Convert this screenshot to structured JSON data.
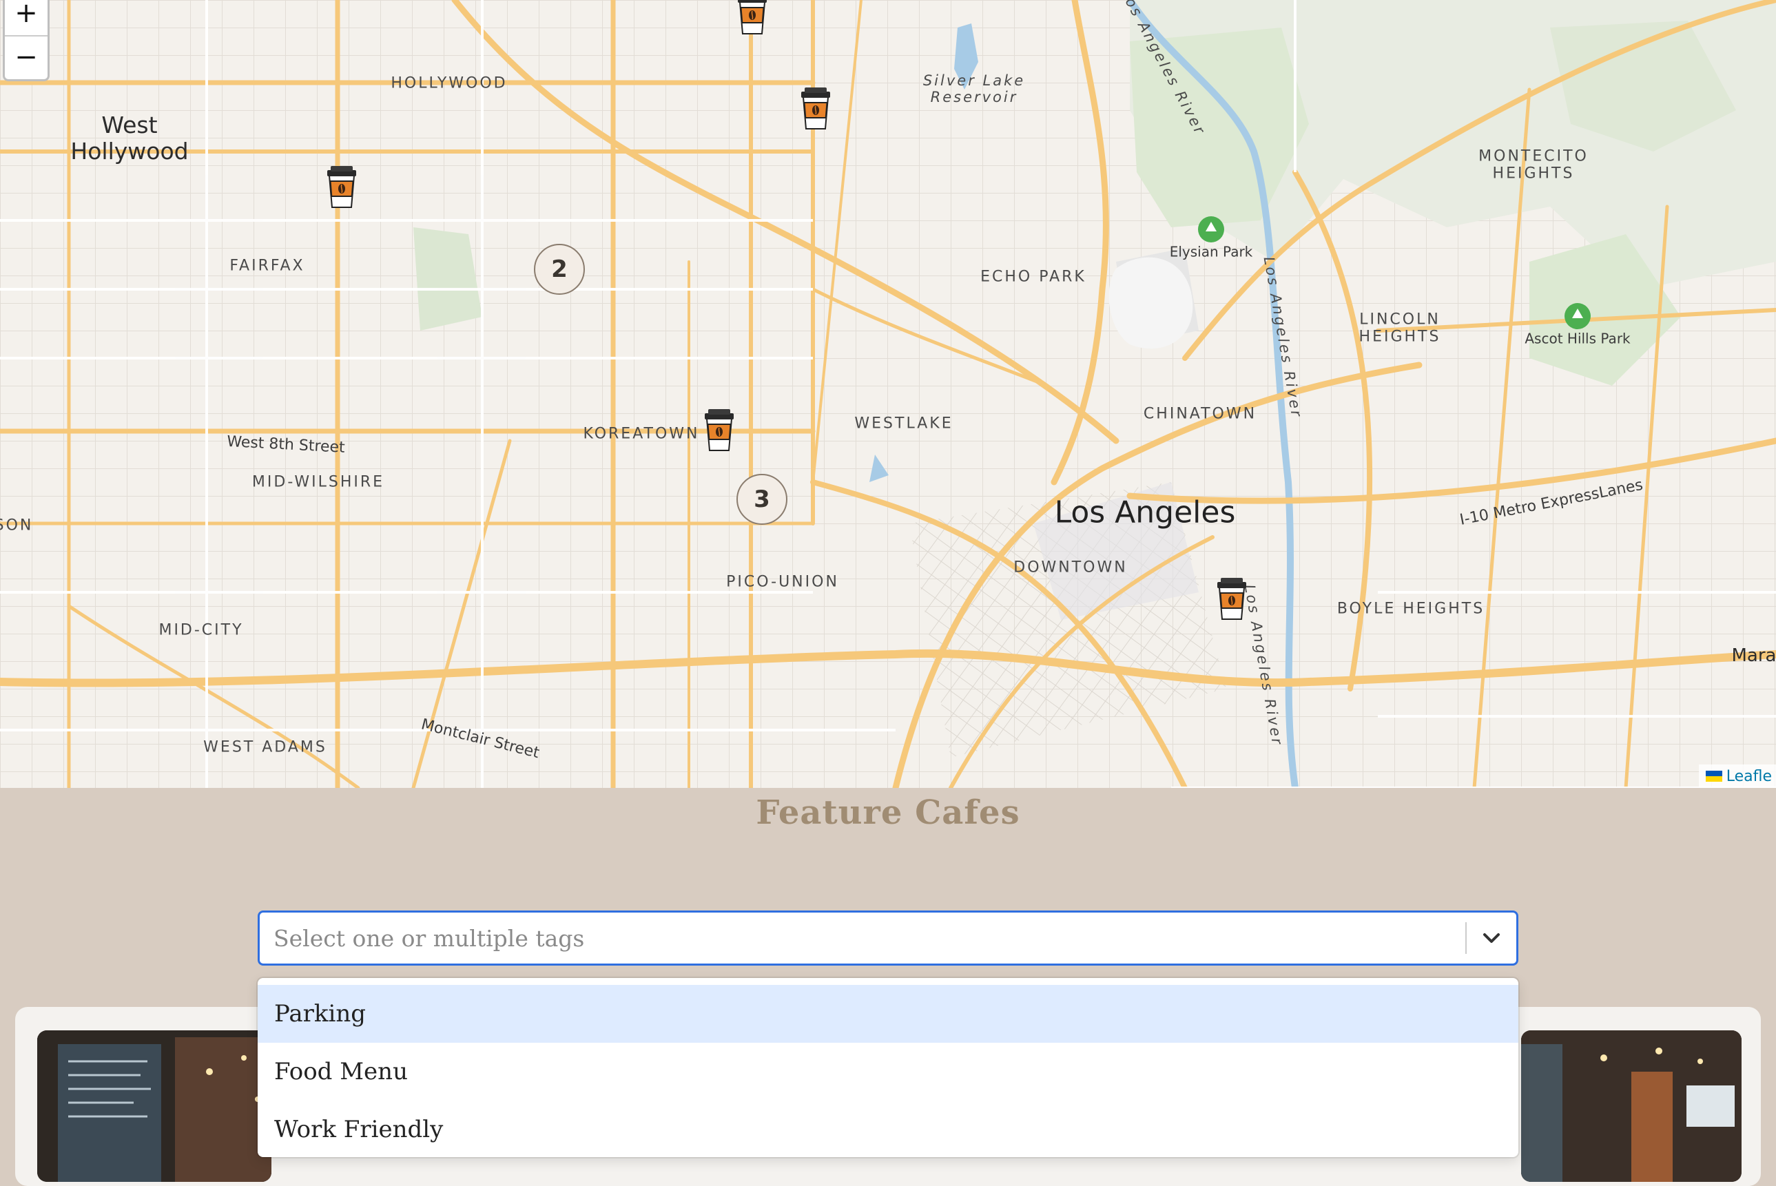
{
  "map": {
    "zoom_in_label": "+",
    "zoom_out_label": "−",
    "attribution": "Leafle",
    "place_labels": {
      "hollywood": "HOLLYWOOD",
      "west_hollywood": "West\nHollywood",
      "silver_lake_reservoir": "Silver Lake\nReservoir",
      "los_angeles_river_1": "Los Angeles River",
      "los_angeles_river_2": "Los Angeles River",
      "los_angeles_river_3": "Los Angeles River",
      "montecito_heights": "MONTECITO\nHEIGHTS",
      "elysian_park": "Elysian Park",
      "fairfax": "FAIRFAX",
      "echo_park": "ECHO PARK",
      "lincoln_heights": "LINCOLN\nHEIGHTS",
      "ascot_hills_park": "Ascot Hills Park",
      "chinatown": "CHINATOWN",
      "westlake": "WESTLAKE",
      "koreatown": "KOREATOWN",
      "west_8th_street": "West 8th Street",
      "mid_wilshire": "MID-WILSHIRE",
      "son_fragment": "SON",
      "los_angeles": "Los Angeles",
      "i10_expresslanes": "I-10 Metro ExpressLanes",
      "downtown": "DOWNTOWN",
      "pico_union": "PICO-UNION",
      "boyle_heights": "BOYLE HEIGHTS",
      "mid_city": "MID-CITY",
      "mara_fragment": "Mara",
      "west_adams": "WEST ADAMS",
      "montclair_street": "Montclair Street"
    },
    "clusters": [
      "2",
      "3"
    ]
  },
  "feature": {
    "title": "Feature Cafes",
    "select_placeholder": "Select one or multiple tags",
    "options": [
      "Parking",
      "Food Menu",
      "Work Friendly"
    ]
  },
  "colors": {
    "accent_blue": "#2f6fe0",
    "option_focus": "#deebff",
    "title_brown": "#a08c73",
    "section_bg": "#d8ccc1",
    "road_major": "#f6c87a",
    "marker_orange": "#e8832a"
  }
}
